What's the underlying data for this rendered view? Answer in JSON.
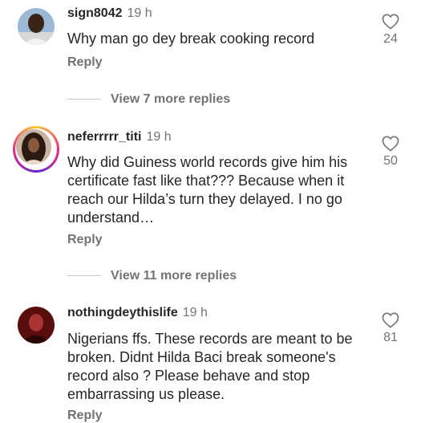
{
  "comments": [
    {
      "username": "sign8042",
      "time": "19 h",
      "text": "Why man go dey break cooking record",
      "likes": "24",
      "reply_label": "Reply"
    },
    {
      "username": "neferrrrr_titi",
      "time": "19 h",
      "text": "Why did Guiness world records give him his certificate fast like that??? Because when it reach our Hilda’s turn they delayed. I no go understand…",
      "likes": "50",
      "reply_label": "Reply"
    },
    {
      "username": "nothingdeythislife",
      "time": "19 h",
      "text": "Nigerians ffs. These records are meant to be broken.  Didnt Hilda Baci break someone's record also ? Please behave and stop embarrassing us please.",
      "likes": "81",
      "reply_label": "Reply"
    }
  ],
  "view_more": [
    {
      "label": "View 7 more replies"
    },
    {
      "label": "View 11 more replies"
    }
  ],
  "icons": {
    "like": "heart-icon"
  },
  "colors": {
    "text": "#262626",
    "secondary": "#737373"
  }
}
